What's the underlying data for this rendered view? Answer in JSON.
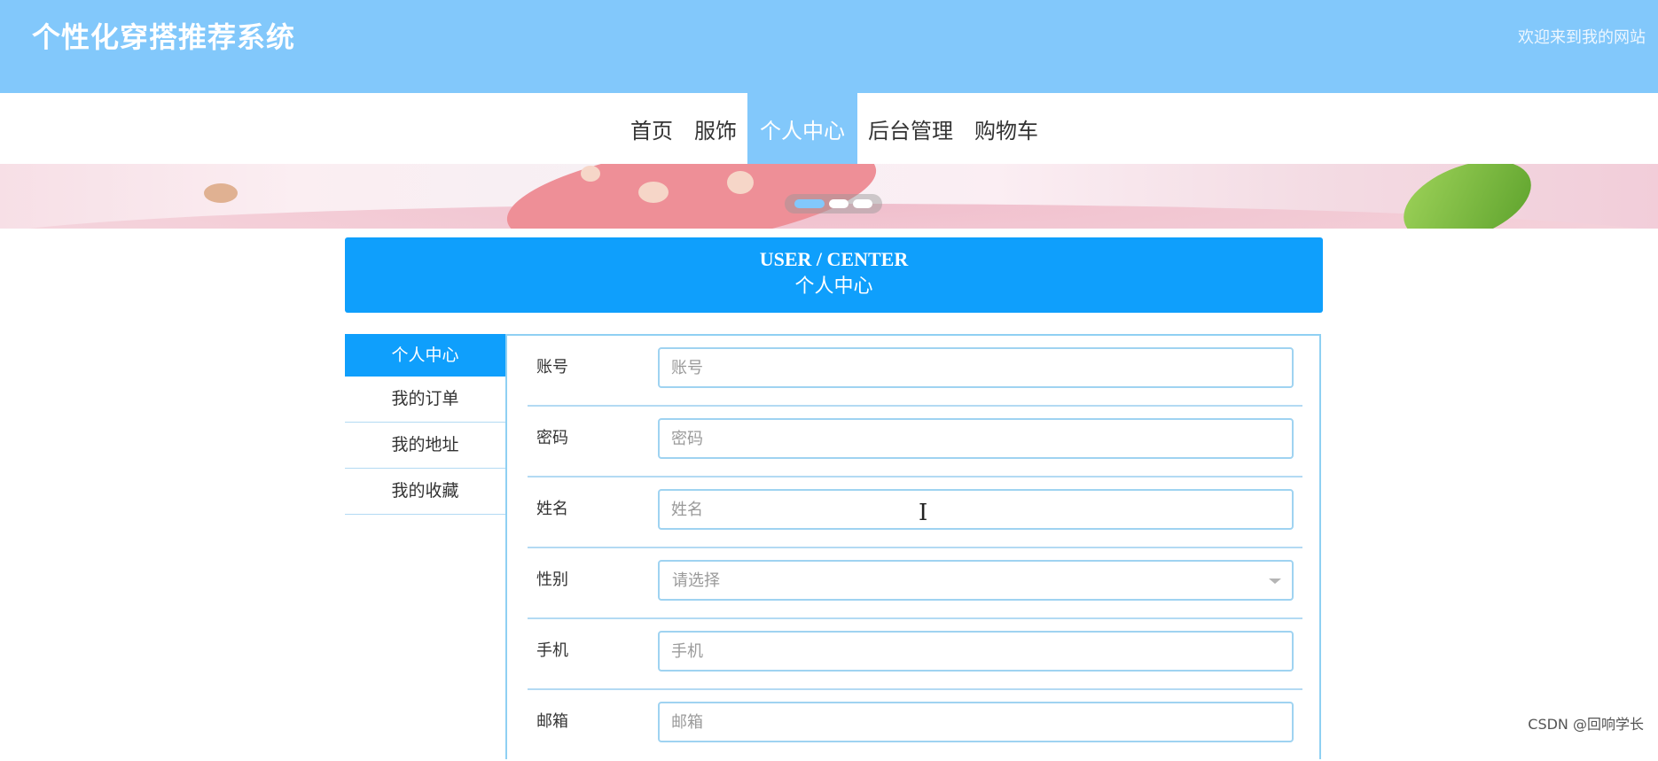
{
  "header": {
    "site_title": "个性化穿搭推荐系统",
    "welcome": "欢迎来到我的网站"
  },
  "nav": {
    "items": [
      {
        "label": "首页"
      },
      {
        "label": "服饰"
      },
      {
        "label": "个人中心",
        "active": true
      },
      {
        "label": "后台管理"
      },
      {
        "label": "购物车"
      }
    ]
  },
  "banner": {
    "carousel_total": 3,
    "carousel_active": 1
  },
  "user_center": {
    "title_en": "USER / CENTER",
    "title_cn": "个人中心"
  },
  "sidebar": {
    "items": [
      {
        "label": "个人中心",
        "active": true
      },
      {
        "label": "我的订单"
      },
      {
        "label": "我的地址"
      },
      {
        "label": "我的收藏"
      }
    ]
  },
  "form": {
    "account": {
      "label": "账号",
      "value": "",
      "placeholder": "账号"
    },
    "password": {
      "label": "密码",
      "value": "",
      "placeholder": "密码"
    },
    "name": {
      "label": "姓名",
      "value": "",
      "placeholder": "姓名"
    },
    "gender": {
      "label": "性别",
      "selected": "请选择"
    },
    "phone": {
      "label": "手机",
      "value": "",
      "placeholder": "手机"
    },
    "email": {
      "label": "邮箱",
      "value": "",
      "placeholder": "邮箱"
    }
  },
  "watermark": "CSDN @回响学长",
  "colors": {
    "header_bg": "#82c8fb",
    "primary": "#0f9ffc",
    "border": "#8fd0f3"
  },
  "icons": {
    "select_caret": "chevron-down-icon",
    "cursor": "text-cursor-icon"
  }
}
